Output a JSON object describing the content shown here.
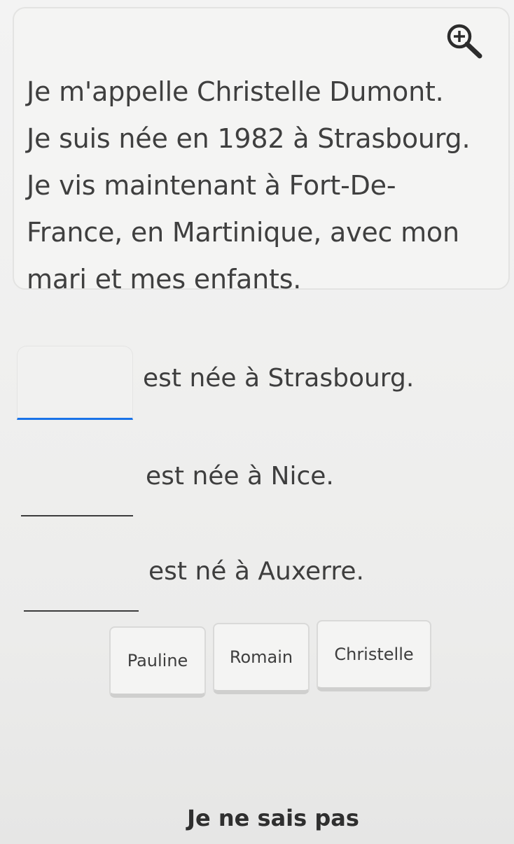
{
  "passage": {
    "lines": [
      "Je m'appelle Christelle Dumont.",
      "Je suis née en 1982 à Strasbourg.",
      "Je vis maintenant à Fort-De-",
      "France, en Martinique, avec mon",
      "mari et mes enfants."
    ],
    "zoom_icon": "zoom-in-icon"
  },
  "exercise": {
    "sentences": [
      {
        "blank_value": "",
        "text": "est née à Strasbourg."
      },
      {
        "blank_value": "",
        "text": "est née à Nice."
      },
      {
        "blank_value": "",
        "text": "est né à Auxerre."
      }
    ],
    "word_bank": [
      "Pauline",
      "Romain",
      "Christelle"
    ]
  },
  "footer": {
    "dont_know_label": "Je ne sais pas"
  },
  "colors": {
    "active_blank_underline": "#1a73e8",
    "text": "#3e3e3e"
  }
}
